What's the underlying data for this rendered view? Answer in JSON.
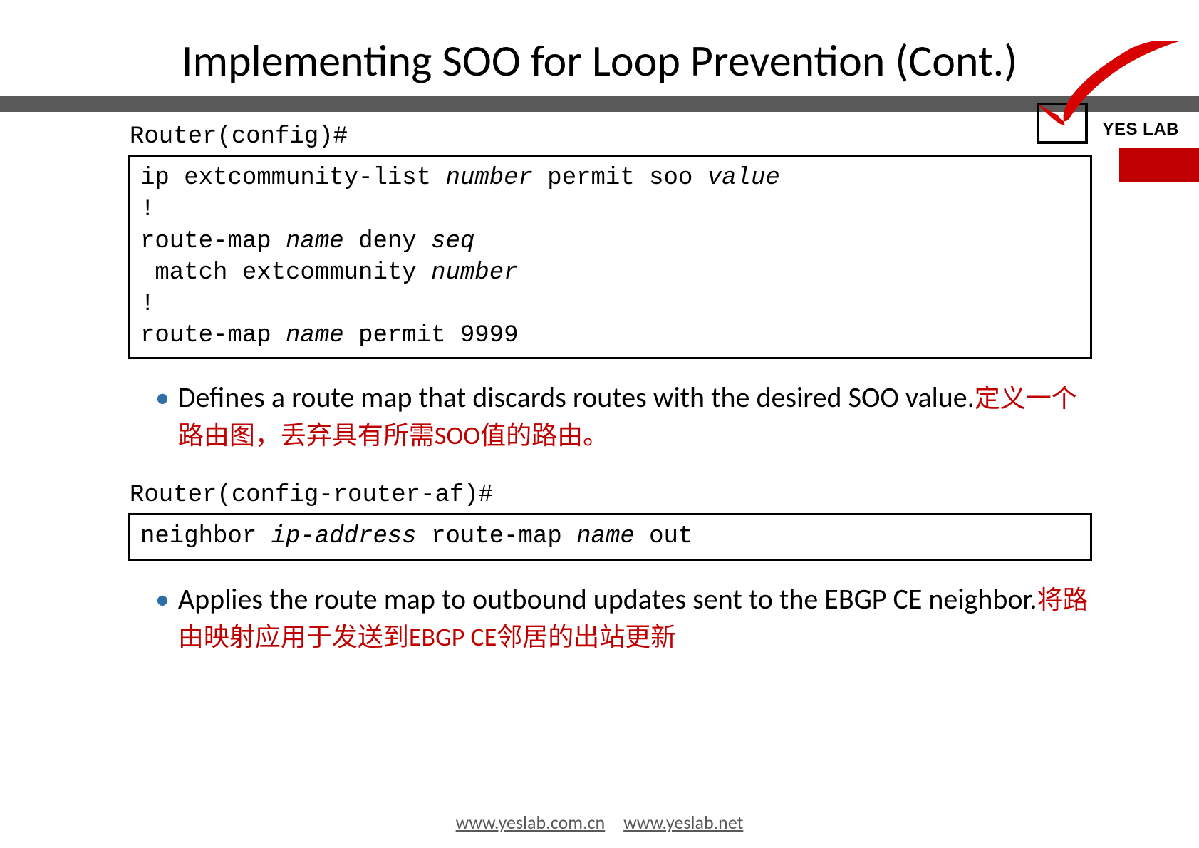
{
  "title": "Implementing SOO for Loop Prevention (Cont.)",
  "logo": {
    "text": "YES LAB"
  },
  "block1": {
    "prompt": "Router(config)#",
    "code": {
      "l1_a": "ip extcommunity-list ",
      "l1_b": "number",
      "l1_c": " permit soo ",
      "l1_d": "value",
      "l2": "!",
      "l3_a": "route-map ",
      "l3_b": "name",
      "l3_c": " deny ",
      "l3_d": "seq",
      "l4_a": " match extcommunity ",
      "l4_b": "number",
      "l5": "!",
      "l6_a": "route-map ",
      "l6_b": "name",
      "l6_c": " permit 9999"
    },
    "bullet_en": "Defines a route map that discards routes with the desired SOO value.",
    "bullet_zh": "定义一个路由图，丢弃具有所需SOO值的路由。"
  },
  "block2": {
    "prompt": "Router(config-router-af)#",
    "code": {
      "l1_a": "neighbor ",
      "l1_b": "ip-address",
      "l1_c": " route-map ",
      "l1_d": "name",
      "l1_e": " out"
    },
    "bullet_en": "Applies the route map to outbound updates sent to the EBGP CE neighbor.",
    "bullet_zh": "将路由映射应用于发送到EBGP CE邻居的出站更新"
  },
  "footer": {
    "link1": "www.yeslab.com.cn",
    "link2": "www.yeslab.net"
  }
}
